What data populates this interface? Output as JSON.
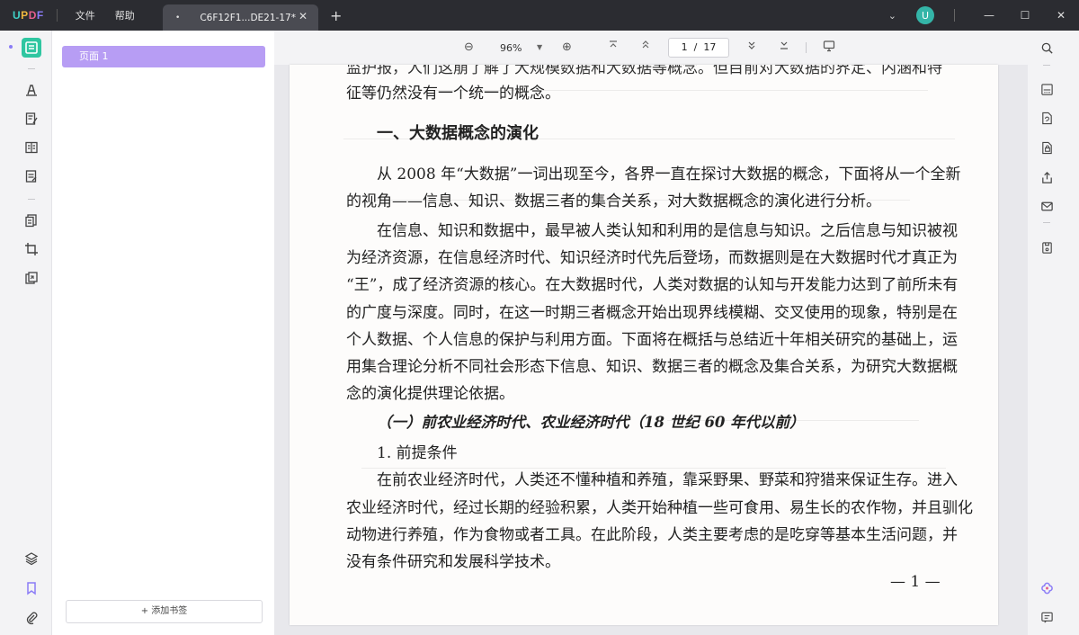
{
  "app": {
    "brand": [
      "U",
      "P",
      "D",
      "F"
    ],
    "menu": [
      "文件",
      "帮助"
    ],
    "tab": {
      "dot": "•",
      "title": "C6F12F1...DE21-17*",
      "close": "✕"
    },
    "new_tab": "+",
    "avatar_letter": "U",
    "window_controls": {
      "minimize": "—",
      "maximize": "☐",
      "close": "✕"
    },
    "accent": "#2fc6a1",
    "bookmark_color": "#b79df4"
  },
  "sidebar": {
    "bookmark_item": "页面 1",
    "add_bookmark": "+ 添加书签"
  },
  "toolbar": {
    "zoom_out": "⊖",
    "zoom": "96%",
    "zoom_in": "⊕",
    "current_page": "1",
    "total_pages": "17",
    "page_sep": "/"
  },
  "document": {
    "top_clipped": "监护报，人们这崩了解了大规模数据和大数据等概念。但目前对大数据的界定、内涵和特",
    "lines": [
      "征等仍然没有一个统一的概念。",
      "一、大数据概念的演化",
      "从 2008 年“大数据”一词出现至今，各界一直在探讨大数据的概念，下面将从一个全新",
      "的视角——信息、知识、数据三者的集合关系，对大数据概念的演化进行分析。",
      "在信息、知识和数据中，最早被人类认知和利用的是信息与知识。之后信息与知识被视",
      "为经济资源，在信息经济时代、知识经济时代先后登场，而数据则是在大数据时代才真正为",
      "“王”，成了经济资源的核心。在大数据时代，人类对数据的认知与开发能力达到了前所未有",
      "的广度与深度。同时，在这一时期三者概念开始出现界线模糊、交叉使用的现象，特别是在",
      "个人数据、个人信息的保护与利用方面。下面将在概括与总结近十年相关研究的基础上，运",
      "用集合理论分析不同社会形态下信息、知识、数据三者的概念及集合关系，为研究大数据概",
      "念的演化提供理论依据。",
      "（一）前农业经济时代、农业经济时代（18 世纪 60 年代以前）",
      "1. 前提条件",
      "在前农业经济时代，人类还不懂种植和养殖，靠采野果、野菜和狩猎来保证生存。进入",
      "农业经济时代，经过长期的经验积累，人类开始种植一些可食用、易生长的农作物，并且驯化",
      "动物进行养殖，作为食物或者工具。在此阶段，人类主要考虑的是吃穿等基本生活问题，并",
      "没有条件研究和发展科学技术。"
    ],
    "page_number": "— 1 —"
  }
}
